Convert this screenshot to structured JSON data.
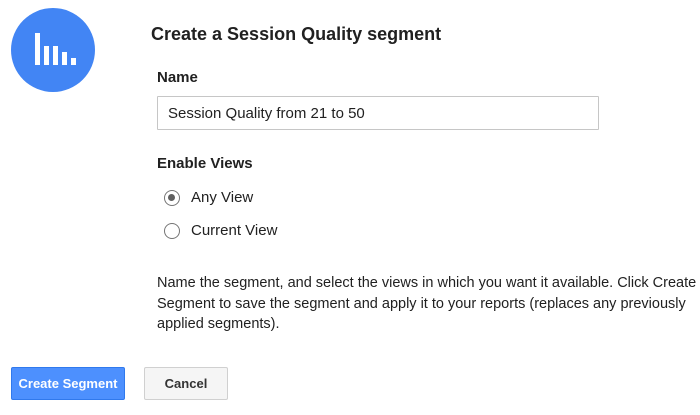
{
  "dialog": {
    "title": "Create a Session Quality segment",
    "icon": "bar-chart-icon",
    "brand_color": "#4285f4"
  },
  "name_field": {
    "label": "Name",
    "value": "Session Quality from 21 to 50"
  },
  "views": {
    "label": "Enable Views",
    "options": [
      {
        "label": "Any View",
        "selected": true
      },
      {
        "label": "Current View",
        "selected": false
      }
    ]
  },
  "description": "Name the segment, and select the views in which you want it available. Click Create Segment to save the segment and apply it to your reports (replaces any previously applied segments).",
  "buttons": {
    "create_label": "Create Segment",
    "cancel_label": "Cancel",
    "primary_color": "#4d90fe"
  }
}
